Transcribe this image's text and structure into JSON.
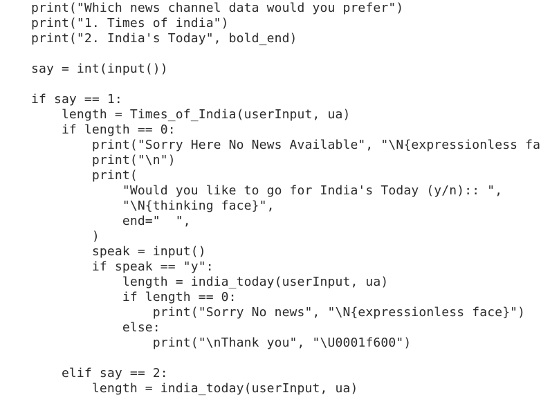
{
  "editor": {
    "lines": [
      "print(\"Which news channel data would you prefer\")",
      "print(\"1. Times of india\")",
      "print(\"2. India's Today\", bold_end)",
      "",
      "say = int(input())",
      "",
      "if say == 1:",
      "    length = Times_of_India(userInput, ua)",
      "    if length == 0:",
      "        print(\"Sorry Here No News Available\", \"\\N{expressionless fa",
      "        print(\"\\n\")",
      "        print(",
      "            \"Would you like to go for India's Today (y/n):: \",",
      "            \"\\N{thinking face}\",",
      "            end=\"  \",",
      "        )",
      "        speak = input()",
      "        if speak == \"y\":",
      "            length = india_today(userInput, ua)",
      "            if length == 0:",
      "                print(\"Sorry No news\", \"\\N{expressionless face}\")",
      "            else:",
      "                print(\"\\nThank you\", \"\\U0001f600\")",
      "",
      "    elif say == 2:",
      "        length = india_today(userInput, ua)"
    ]
  }
}
